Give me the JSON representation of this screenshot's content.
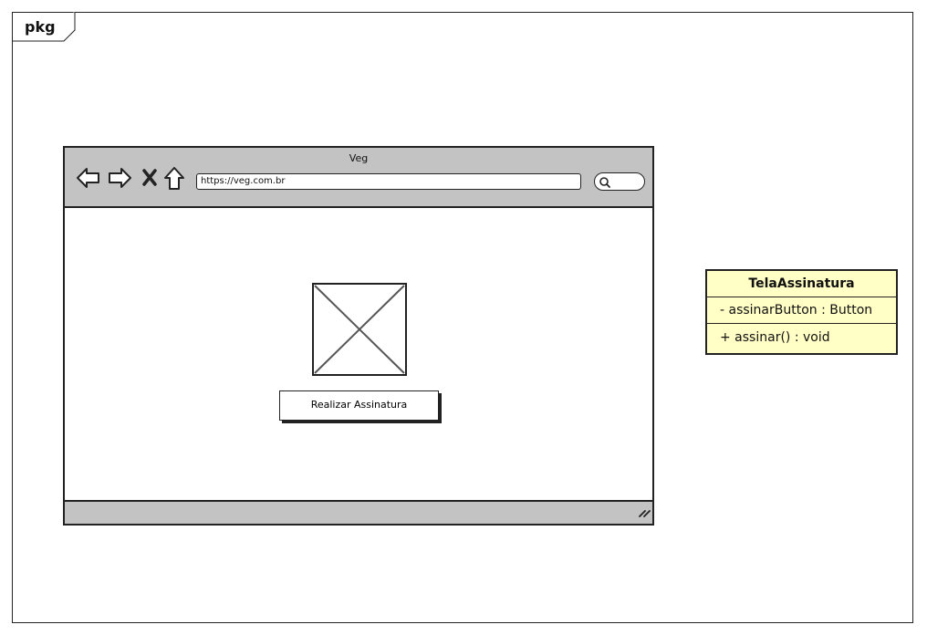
{
  "package": {
    "label": "pkg"
  },
  "browser": {
    "title": "Veg",
    "url": "https://veg.com.br",
    "nav_icons": [
      "back-arrow-icon",
      "forward-arrow-icon",
      "stop-icon",
      "home-icon"
    ],
    "content": {
      "image_placeholder": "image-placeholder-icon",
      "button_label": "Realizar Assinatura"
    }
  },
  "uml_class": {
    "name": "TelaAssinatura",
    "attributes": [
      "- assinarButton : Button"
    ],
    "operations": [
      "+ assinar() : void"
    ]
  },
  "colors": {
    "chrome": "#c3c3c3",
    "uml_fill": "#ffffc6",
    "stroke": "#222222"
  }
}
